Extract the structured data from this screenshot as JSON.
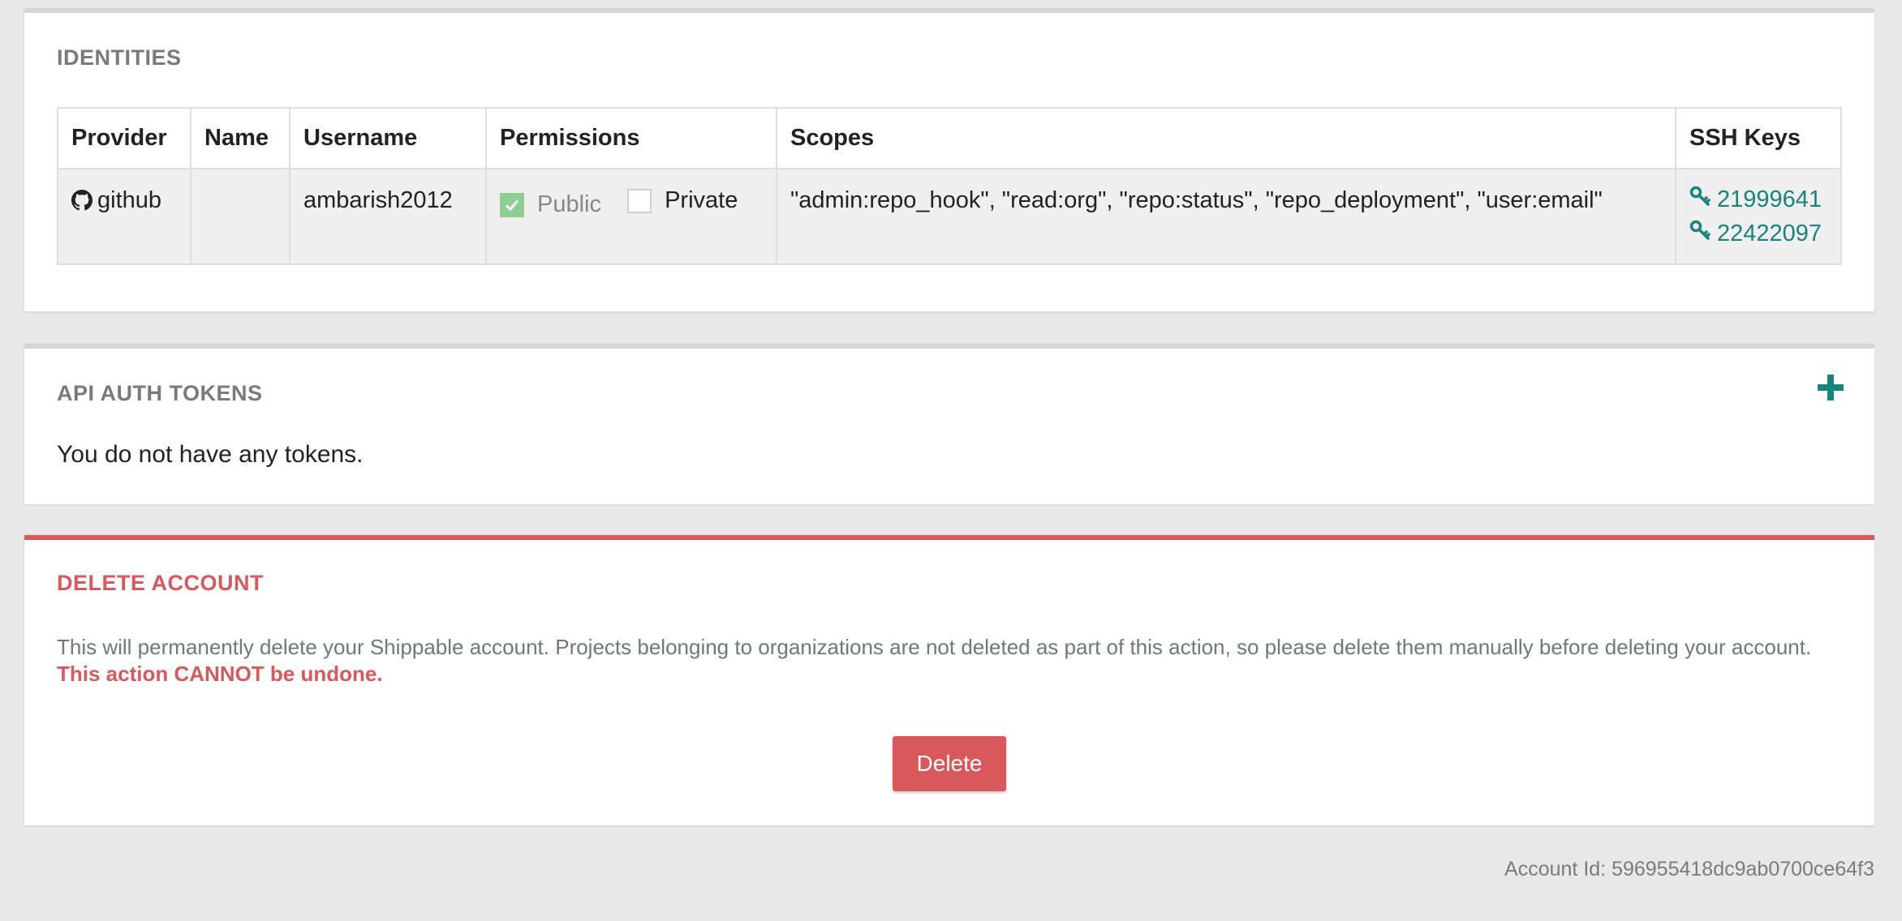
{
  "identities": {
    "title": "IDENTITIES",
    "columns": [
      "Provider",
      "Name",
      "Username",
      "Permissions",
      "Scopes",
      "SSH Keys"
    ],
    "row": {
      "provider": "github",
      "provider_icon": "github-icon",
      "name": "",
      "username": "ambarish2012",
      "permissions": {
        "public": {
          "label": "Public",
          "checked": true
        },
        "private": {
          "label": "Private",
          "checked": false
        }
      },
      "scopes": "\"admin:repo_hook\", \"read:org\", \"repo:status\", \"repo_deployment\", \"user:email\"",
      "ssh_keys": [
        "21999641",
        "22422097"
      ]
    }
  },
  "tokens": {
    "title": "API AUTH TOKENS",
    "add_icon": "plus-icon",
    "empty_message": "You do not have any tokens."
  },
  "delete_account": {
    "title": "DELETE ACCOUNT",
    "description": "This will permanently delete your Shippable account. Projects belonging to organizations are not deleted as part of this action, so please delete them manually before deleting your account.",
    "warning": "This action CANNOT be undone.",
    "button_label": "Delete"
  },
  "footer": {
    "account_id": "Account Id: 596955418dc9ab0700ce64f3"
  },
  "colors": {
    "accent": "#16857e",
    "danger": "#d9585b",
    "checked": "#8fce92",
    "background": "#e8e8e8"
  }
}
